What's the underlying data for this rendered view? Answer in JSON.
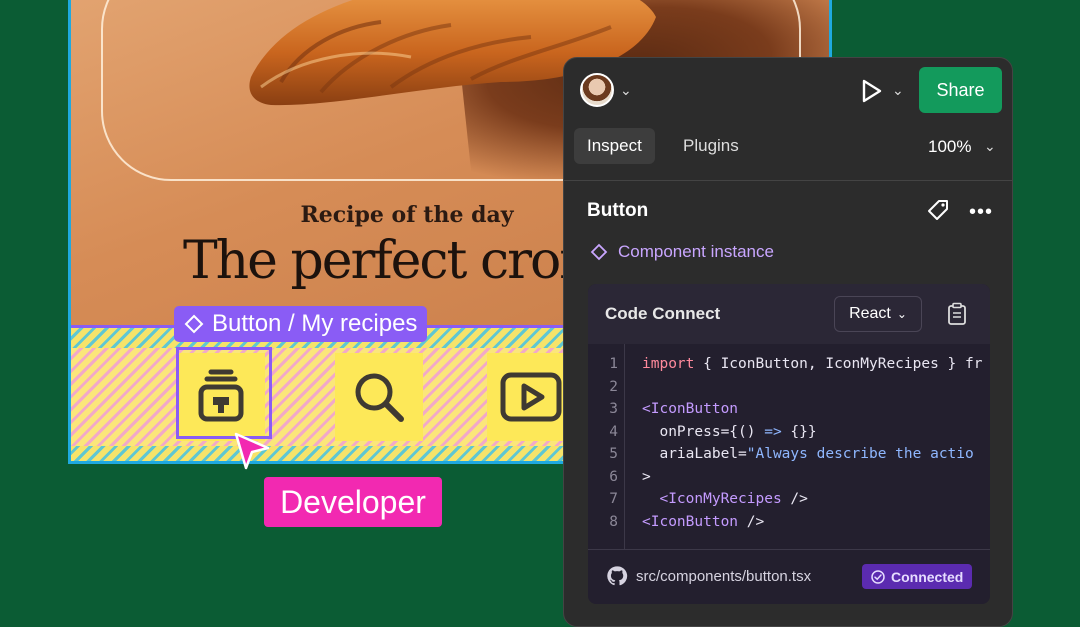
{
  "canvas": {
    "eyebrow": "Recipe of the day",
    "headline": "The perfect croissant",
    "selection_label": "Button / My recipes",
    "collaborator_tag": "Developer",
    "nav_icons": [
      "recipes-icon",
      "search-icon",
      "play-icon"
    ]
  },
  "panel": {
    "share_label": "Share",
    "tabs": [
      {
        "label": "Inspect",
        "active": true
      },
      {
        "label": "Plugins",
        "active": false
      }
    ],
    "zoom": "100%",
    "element_title": "Button",
    "component_type": "Component instance",
    "code_connect": {
      "title": "Code Connect",
      "framework": "React",
      "lines": [
        {
          "n": "1",
          "text": "import { IconButton, IconMyRecipes } from"
        },
        {
          "n": "2",
          "text": ""
        },
        {
          "n": "3",
          "text": "<IconButton"
        },
        {
          "n": "4",
          "text": "  onPress={() => {}}"
        },
        {
          "n": "5",
          "text": "  ariaLabel=\"Always describe the action\""
        },
        {
          "n": "6",
          "text": ">"
        },
        {
          "n": "7",
          "text": "  <IconMyRecipes />"
        },
        {
          "n": "8",
          "text": "<IconButton />"
        }
      ],
      "file_path": "src/components/button.tsx",
      "status": "Connected"
    }
  },
  "colors": {
    "background": "#0b5c34",
    "selection": "#8a5cf5",
    "developer_tag": "#f229b1",
    "share_button": "#139a5c",
    "connected_badge": "#5b2bb0"
  }
}
